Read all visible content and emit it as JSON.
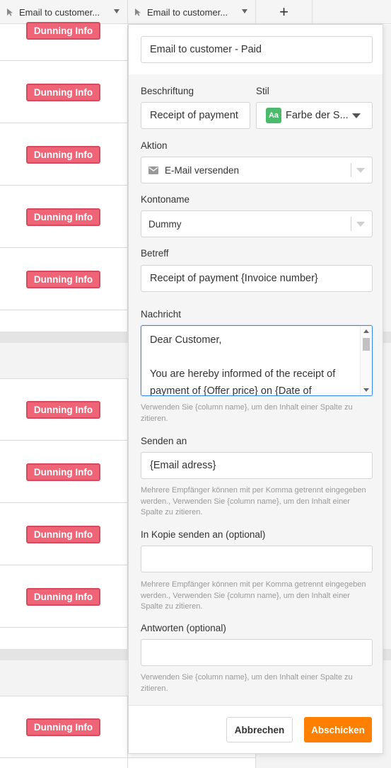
{
  "columns": [
    {
      "label": "Email to customer..."
    },
    {
      "label": "Email to customer..."
    }
  ],
  "add_column_label": "+",
  "badge_label": "Dunning Info",
  "panel": {
    "button_name": "Email to customer - Paid",
    "caption_label": "Beschriftung",
    "caption_value": "Receipt of payment",
    "style_label": "Stil",
    "style_icon_text": "Aa",
    "style_value": "Farbe der S...",
    "style_icon_color": "#4cba6b",
    "action_label": "Aktion",
    "action_value": "E-Mail versenden",
    "account_label": "Kontoname",
    "account_value": "Dummy",
    "subject_label": "Betreff",
    "subject_value": "Receipt of payment {Invoice number}",
    "message_label": "Nachricht",
    "message_value": "Dear Customer,\n\nYou are hereby informed of the receipt of payment of {Offer price} on {Date of",
    "message_help": "Verwenden Sie {column name}, um den Inhalt einer Spalte zu zitieren.",
    "send_to_label": "Senden an",
    "send_to_value": "{Email adress}",
    "send_to_help": "Mehrere Empfänger können mit per Komma getrennt eingegeben werden., Verwenden Sie {column name}, um den Inhalt einer Spalte zu zitieren.",
    "cc_label": "In Kopie senden an (optional)",
    "cc_value": "",
    "cc_help": "Mehrere Empfänger können mit per Komma getrennt eingegeben werden., Verwenden Sie {column name}, um den Inhalt einer Spalte zu zitieren.",
    "reply_label": "Antworten (optional)",
    "reply_value": "",
    "reply_help": "Verwenden Sie {column name}, um den Inhalt einer Spalte zu zitieren.",
    "cancel_label": "Abbrechen",
    "submit_label": "Abschicken"
  },
  "colors": {
    "badge": "#f06478",
    "submit": "#ff8000",
    "focus": "#3a8ee6"
  }
}
